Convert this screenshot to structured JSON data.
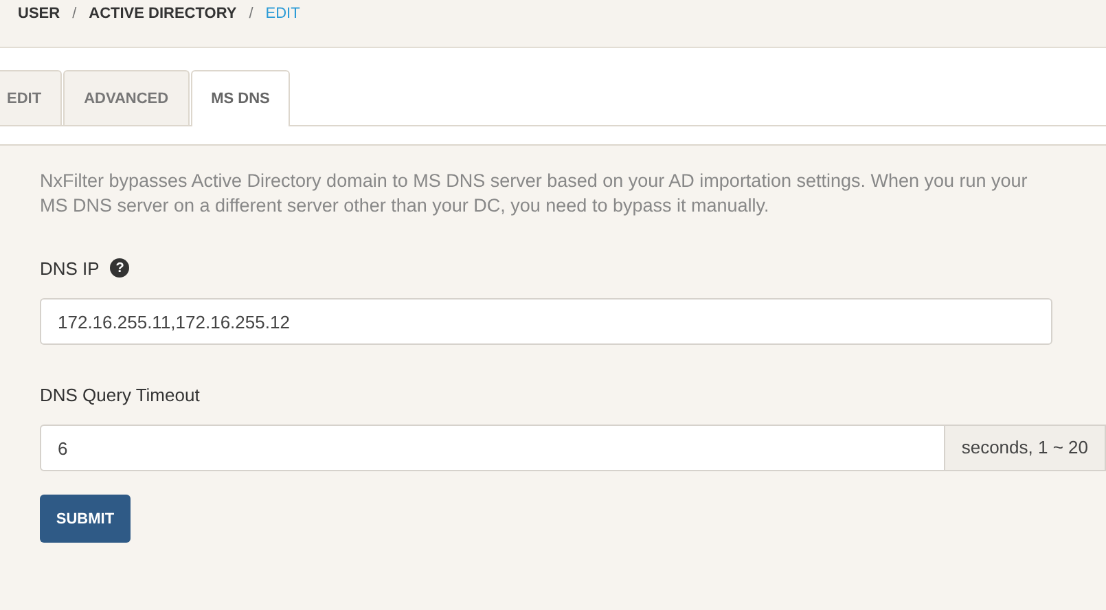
{
  "breadcrumb": [
    {
      "label": "USER",
      "current": false
    },
    {
      "label": "ACTIVE DIRECTORY",
      "current": false
    },
    {
      "label": "EDIT",
      "current": true
    }
  ],
  "breadcrumb_separator": "/",
  "tabs": [
    {
      "label": "EDIT",
      "selected": false
    },
    {
      "label": "ADVANCED",
      "selected": false
    },
    {
      "label": "MS DNS",
      "selected": true
    }
  ],
  "description": "NxFilter bypasses Active Directory domain to MS DNS server based on your AD importation settings. When you run your MS DNS server on a different server other than your DC, you need to bypass it manually.",
  "dns_ip": {
    "label": "DNS IP",
    "help_icon": "?",
    "value": "172.16.255.11,172.16.255.12"
  },
  "timeout": {
    "label": "DNS Query Timeout",
    "value": "6",
    "addon": "seconds, 1 ~ 20"
  },
  "submit": "SUBMIT"
}
